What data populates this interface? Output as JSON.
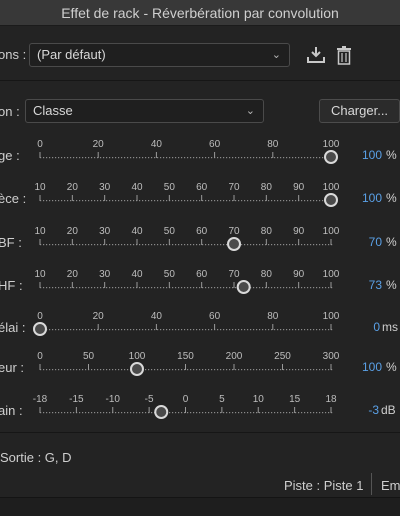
{
  "window": {
    "title": "Effet de rack - Réverbération par convolution"
  },
  "presets": {
    "label": "ons :",
    "value": "(Par défaut)",
    "save_icon": "download-icon",
    "delete_icon": "trash-icon"
  },
  "impulse": {
    "label": "on :",
    "value": "Classe",
    "load_button": "Charger..."
  },
  "sliders": [
    {
      "label": "ge :",
      "ticks": [
        "0",
        "20",
        "40",
        "60",
        "80",
        "100"
      ],
      "min": 0,
      "max": 100,
      "value_fraction": 1.0,
      "value_text": "100",
      "unit": "%"
    },
    {
      "label": "èce :",
      "ticks": [
        "10",
        "20",
        "30",
        "40",
        "50",
        "60",
        "70",
        "80",
        "90",
        "100"
      ],
      "min": 10,
      "max": 100,
      "value_fraction": 1.0,
      "value_text": "100",
      "unit": "%"
    },
    {
      "label": "BF :",
      "ticks": [
        "10",
        "20",
        "30",
        "40",
        "50",
        "60",
        "70",
        "80",
        "90",
        "100"
      ],
      "min": 10,
      "max": 100,
      "value_fraction": 0.6667,
      "value_text": "70",
      "unit": "%"
    },
    {
      "label": "HF :",
      "ticks": [
        "10",
        "20",
        "30",
        "40",
        "50",
        "60",
        "70",
        "80",
        "90",
        "100"
      ],
      "min": 10,
      "max": 100,
      "value_fraction": 0.7,
      "value_text": "73",
      "unit": "%"
    },
    {
      "label": "élai :",
      "ticks": [
        "0",
        "20",
        "40",
        "60",
        "80",
        "100"
      ],
      "min": 0,
      "max": 100,
      "value_fraction": 0.0,
      "value_text": "0",
      "unit": "ms"
    },
    {
      "label": "eur :",
      "ticks": [
        "0",
        "50",
        "100",
        "150",
        "200",
        "250",
        "300"
      ],
      "min": 0,
      "max": 300,
      "value_fraction": 0.3333,
      "value_text": "100",
      "unit": "%"
    },
    {
      "label": "ain :",
      "ticks": [
        "-18",
        "-15",
        "-10",
        "-5",
        "0",
        "5",
        "10",
        "15",
        "18"
      ],
      "min": -18,
      "max": 18,
      "value_fraction": 0.4167,
      "value_text": "-3",
      "unit": "dB"
    }
  ],
  "output": {
    "label": "Sortie : G, D"
  },
  "footer": {
    "track": "Piste : Piste 1",
    "extra": "Em"
  },
  "colors": {
    "accent_value": "#5aa0e6",
    "background": "#232323"
  }
}
